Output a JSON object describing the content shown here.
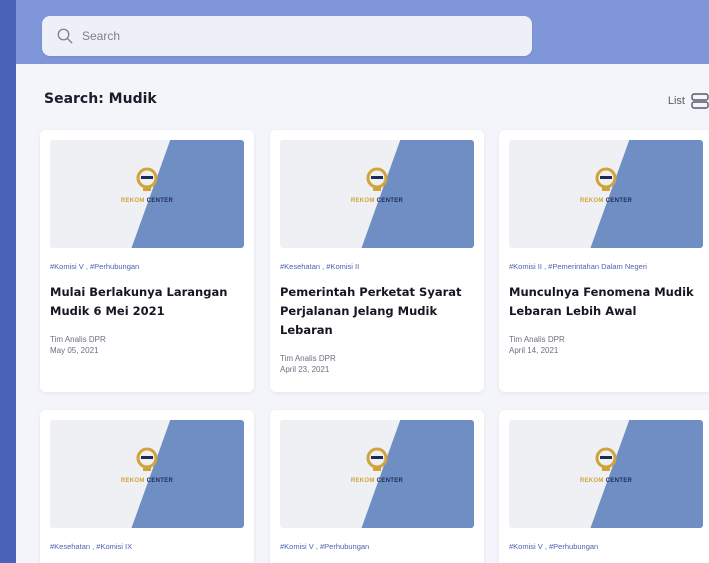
{
  "search": {
    "placeholder": "Search"
  },
  "page": {
    "heading": "Search: Mudik",
    "view_label": "List"
  },
  "logo": {
    "word1": "REKOM",
    "word2": "CENTER"
  },
  "cards": [
    {
      "tags": "#Komisi V , #Perhubungan",
      "title": "Mulai Berlakunya Larangan Mudik 6 Mei 2021",
      "author": "Tim Analis DPR",
      "date": "May 05, 2021"
    },
    {
      "tags": "#Kesehatan , #Komisi II",
      "title": "Pemerintah Perketat Syarat Perjalanan Jelang Mudik Lebaran",
      "author": "Tim Analis DPR",
      "date": "April 23, 2021"
    },
    {
      "tags": "#Komisi II , #Pemerintahan Dalam Negeri",
      "title": "Munculnya Fenomena Mudik Lebaran Lebih Awal",
      "author": "Tim Analis DPR",
      "date": "April 14, 2021"
    },
    {
      "tags": "#Kesehatan , #Komisi IX"
    },
    {
      "tags": "#Komisi V , #Perhubungan"
    },
    {
      "tags": "#Komisi V , #Perhubungan"
    }
  ]
}
